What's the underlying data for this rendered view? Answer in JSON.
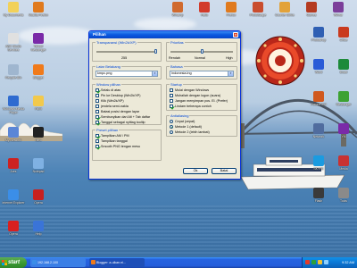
{
  "desktop": {
    "icons": [
      {
        "label": "My Documents",
        "color": "#f2d15a"
      },
      {
        "label": "ABC Studio Services",
        "color": "#e0e0e0"
      },
      {
        "label": "Recycle Bin",
        "color": "#9fb6cf"
      },
      {
        "label": "Windows Media Player",
        "color": "#2f6bd0"
      },
      {
        "label": "My Network",
        "color": "#5b86d6"
      },
      {
        "label": "Ares",
        "color": "#c22"
      },
      {
        "label": "Internet Explorer",
        "color": "#3b8ee8"
      },
      {
        "label": "Opera",
        "color": "#d82020"
      },
      {
        "label": "Mozilla Firefox",
        "color": "#e07a1e"
      },
      {
        "label": "Yahoo! Messenger",
        "color": "#7a2aa8"
      },
      {
        "label": "Blogger",
        "color": "#f07a1a"
      },
      {
        "label": "Paint",
        "color": "#f2c94c"
      },
      {
        "label": "Nero",
        "color": "#222"
      },
      {
        "label": "Notepad",
        "color": "#7fb1e3"
      },
      {
        "label": "Opera",
        "color": "#c82020"
      },
      {
        "label": "Help",
        "color": "#3a74d8"
      }
    ],
    "top_icons": [
      {
        "label": "Winamp",
        "color": "#d06a2e"
      },
      {
        "label": "Hello",
        "color": "#d23b2b"
      },
      {
        "label": "Firefox",
        "color": "#e07a1e"
      },
      {
        "label": "PhotoScape",
        "color": "#c94d2e"
      },
      {
        "label": "Counter Strike",
        "color": "#e2a23a"
      },
      {
        "label": "Games",
        "color": "#b43a20"
      },
      {
        "label": "Winrar",
        "color": "#7b3e9a"
      }
    ],
    "right_icons": [
      {
        "label": "Photoshop",
        "color": "#2f5fb3"
      },
      {
        "label": "Office",
        "color": "#c93a1e"
      },
      {
        "label": "Word",
        "color": "#2a5bd7"
      },
      {
        "label": "Excel",
        "color": "#1d8a3a"
      },
      {
        "label": "PowerPoint",
        "color": "#d0581e"
      },
      {
        "label": "Messenger",
        "color": "#3ca232"
      },
      {
        "label": "Network",
        "color": "#506c9e"
      },
      {
        "label": "YM",
        "color": "#7a2aa8"
      },
      {
        "label": "SKYPE",
        "color": "#1b9be0"
      },
      {
        "label": "Media",
        "color": "#c83232"
      },
      {
        "label": "Flash",
        "color": "#3a3a3a"
      },
      {
        "label": "Tools",
        "color": "#8a8a8a"
      }
    ]
  },
  "dialog": {
    "title": "Pilihan",
    "close": "×",
    "transparency": {
      "label": "Transparansi (Win2k/XP)",
      "value_label": "255",
      "level_fraction": 1.0
    },
    "priority": {
      "label": "Prioritas",
      "ticks": [
        "Rendah",
        "Normal",
        "High"
      ],
      "level_fraction": 0.5
    },
    "skin": {
      "label": "Latar Belakang",
      "value": "kmpc.png"
    },
    "language": {
      "label": "Bahasa",
      "value": "Indonesia.lng"
    },
    "window_group": {
      "label": "Window pilihan",
      "items": [
        {
          "text": "Selalu di atas",
          "checked": true
        },
        {
          "text": "Pin ke Desktop (Win2k/XP)",
          "checked": false
        },
        {
          "text": "Klik (Win2k/XP)",
          "checked": false
        },
        {
          "text": "jendela semi-nakla",
          "checked": false
        },
        {
          "text": "Batasi posisi dengan layar",
          "checked": false
        },
        {
          "text": "Sembunyikan dari Alt + Tab daftar",
          "checked": true
        },
        {
          "text": "Tanggal sebagai nyittag tooltip",
          "checked": true
        }
      ]
    },
    "preset_group": {
      "label": "Preset pilihan",
      "items": [
        {
          "text": "Tampilkan AM / PM",
          "checked": true
        },
        {
          "text": "Tampilkan tanggal",
          "checked": false
        },
        {
          "text": "Smooth PNG tengan mesu",
          "checked": true
        }
      ]
    },
    "startup_group": {
      "label": "Startup",
      "items": [
        {
          "text": "Mulai dengan Windows",
          "checked": false
        },
        {
          "text": "Muhaliah dengan logon (suara)",
          "checked": false
        },
        {
          "text": "Jangan menyimpan pos. El. (Prefer)",
          "checked": false
        },
        {
          "text": "Lindam beberapa contoh",
          "checked": true
        }
      ]
    },
    "alarm_group": {
      "label": "Antialiasing",
      "items": [
        {
          "text": "Cepat (cepat)",
          "checked": false
        },
        {
          "text": "Metode 1 (default)",
          "checked": true
        },
        {
          "text": "Metode 2 (lebih lambat)",
          "checked": false
        }
      ]
    },
    "ok_label": "Ok",
    "cancel_label": "Batal"
  },
  "taskbar": {
    "start_label": "start",
    "items": [
      {
        "label": "192.168.2.100",
        "color": "#3b8ee8"
      },
      {
        "label": "Blogger: a-ulkan.ni...",
        "color": "#f07a1a"
      }
    ],
    "clock": "9:32 AM"
  }
}
